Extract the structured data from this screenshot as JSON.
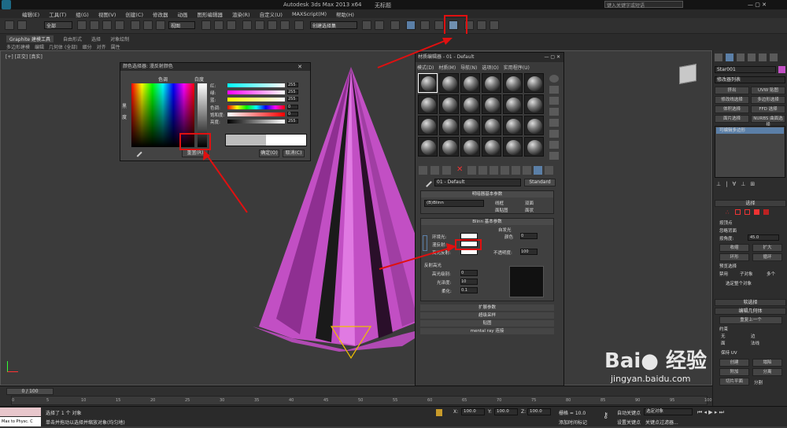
{
  "title": {
    "app": "Autodesk 3ds Max  2013 x64",
    "file": "无标题",
    "search": "键入关键字或短语"
  },
  "menu": [
    "编辑(E)",
    "工具(T)",
    "组(G)",
    "视图(V)",
    "创建(C)",
    "修改器",
    "动画",
    "图形编辑器",
    "渲染(R)",
    "自定义(U)",
    "MAXScript(M)",
    "帮助(H)"
  ],
  "toolbar": {
    "selection_filter": "全部",
    "ref_coord": "视图",
    "named_sel": "创建选择集"
  },
  "ribbon": {
    "tabs": [
      "Graphite 建模工具",
      "自由形式",
      "选择",
      "对象绘制"
    ],
    "sub": [
      "多边形建模",
      "编辑",
      "几何体 (全部)",
      "细分",
      "对齐",
      "属性"
    ]
  },
  "viewport": {
    "label": "[+] [正交] [真实]"
  },
  "colorpicker": {
    "title": "颜色选择器: 漫反射颜色",
    "hue_label": "色调",
    "white_label": "白度",
    "black_label": "黑",
    "black_label2": "度",
    "rows": [
      {
        "label": "红:",
        "value": "255"
      },
      {
        "label": "绿:",
        "value": "255"
      },
      {
        "label": "蓝:",
        "value": "255"
      },
      {
        "label": "色调:",
        "value": "0"
      },
      {
        "label": "饱和度:",
        "value": "0"
      },
      {
        "label": "亮度:",
        "value": "255"
      }
    ],
    "reset": "重置(R)",
    "ok": "确定(O)",
    "cancel": "取消(C)"
  },
  "mateditor": {
    "title": "材质编辑器 - 01 - Default",
    "menu": [
      "模式(D)",
      "材质(M)",
      "导航(N)",
      "选项(O)",
      "实用程序(U)"
    ],
    "mat_name": "01 - Default",
    "mat_type": "Standard",
    "shader_head": "明暗器基本参数",
    "shader": "(B)Blinn",
    "wire": "线框",
    "twoside": "双面",
    "facemap": "面贴图",
    "faceted": "面状",
    "blinn_head": "Blinn 基本参数",
    "selfillum": "自发光",
    "color": "颜色",
    "color_val": "0",
    "ambient": "环境光:",
    "diffuse": "漫反射:",
    "specular": "高光反射:",
    "opacity": "不透明度:",
    "opacity_val": "100",
    "spec_head": "反射高光",
    "spec_level": "高光级别:",
    "spec_level_val": "0",
    "gloss": "光泽度:",
    "gloss_val": "10",
    "soften": "柔化:",
    "soften_val": "0.1",
    "rollouts": [
      "扩展参数",
      "超级采样",
      "贴图",
      "mental ray 连接"
    ]
  },
  "cmdpanel": {
    "obj": "Star001",
    "modlist": "修改器列表",
    "btns": [
      "挤出",
      "UVW 贴图",
      "修改线选择",
      "多边形选择",
      "体积选择",
      "FFD 选择",
      "面片选择",
      "NURBS 曲面选择"
    ],
    "stack_item": "可编辑多边形",
    "select_head": "选择",
    "byvertex": "按顶点",
    "ignore": "忽略背面",
    "angle": "按角度:",
    "angle_val": "45.0",
    "shrink": "收缩",
    "grow": "扩大",
    "ring": "环形",
    "loop": "循环",
    "preview": "预览选择",
    "disabled": "禁用",
    "subobj": "子对象",
    "multi": "多个",
    "selcount": "选定整个对象",
    "softsel": "软选择",
    "editgeo": "编辑几何体",
    "repeat": "重复上一个",
    "constraint": "约束",
    "none": "无",
    "edge": "边",
    "face": "面",
    "normal": "法线",
    "preserveuv": "保持 UV",
    "create": "创建",
    "collapse": "塌陷",
    "attach": "附加",
    "detach": "分离",
    "slice_plane": "切片平面",
    "split": "分割"
  },
  "timeline": {
    "frame": "0 / 100",
    "ticks": [
      "0",
      "5",
      "10",
      "15",
      "20",
      "25",
      "30",
      "35",
      "40",
      "45",
      "50",
      "55",
      "60",
      "65",
      "70",
      "75",
      "80",
      "85",
      "90",
      "95",
      "100"
    ]
  },
  "status": {
    "sel": "选择了 1 个 对象",
    "hint": "单击并拖动以选择并缩放对象(均匀地)",
    "script": "Max to Physc. C",
    "x": "100.0",
    "y": "100.0",
    "z": "100.0",
    "grid": "栅格 = 10.0",
    "autokey": "自动关键点",
    "selobj": "选定对象",
    "setkey": "设置关键点",
    "keyfilter": "关键点过滤器...",
    "addtime": "添加时间标记"
  },
  "watermark": "jingyan.baidu.com",
  "colors": {
    "accent": "#e01010",
    "pink": "#c24fc4"
  }
}
